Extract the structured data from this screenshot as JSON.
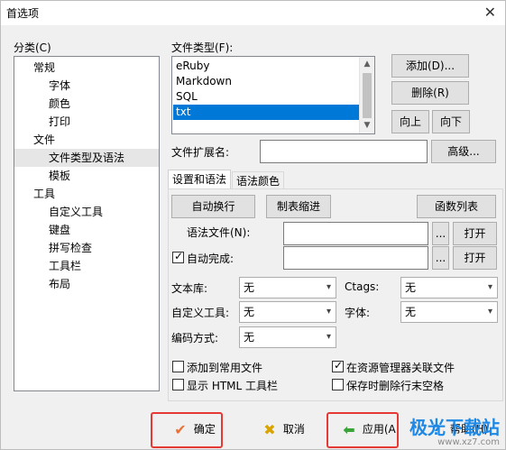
{
  "window": {
    "title": "首选项"
  },
  "category": {
    "label": "分类(C)",
    "items": [
      {
        "label": "常规",
        "level": 0
      },
      {
        "label": "字体",
        "level": 1
      },
      {
        "label": "颜色",
        "level": 1
      },
      {
        "label": "打印",
        "level": 1
      },
      {
        "label": "文件",
        "level": 0
      },
      {
        "label": "文件类型及语法",
        "level": 1,
        "selected": true
      },
      {
        "label": "模板",
        "level": 1
      },
      {
        "label": "工具",
        "level": 0
      },
      {
        "label": "自定义工具",
        "level": 1
      },
      {
        "label": "键盘",
        "level": 1
      },
      {
        "label": "拼写检查",
        "level": 1
      },
      {
        "label": "工具栏",
        "level": 1
      },
      {
        "label": "布局",
        "level": 1
      }
    ]
  },
  "file_type": {
    "label": "文件类型(F):",
    "items": [
      "eRuby",
      "Markdown",
      "SQL",
      "txt"
    ],
    "selected": "txt",
    "buttons": {
      "add": "添加(D)...",
      "delete": "删除(R)",
      "up": "向上",
      "down": "向下"
    }
  },
  "extension": {
    "label": "文件扩展名:",
    "value": "",
    "advanced": "高级..."
  },
  "tabs": {
    "syntax": "设置和语法",
    "color": "语法颜色"
  },
  "syntax": {
    "auto_wrap": "自动换行",
    "tab_indent": "制表缩进",
    "function_list": "函数列表",
    "syntax_file_label": "语法文件(N):",
    "syntax_file_value": "",
    "auto_complete_label": "自动完成:",
    "auto_complete_checked": true,
    "auto_complete_value": "",
    "browse": "...",
    "open": "打开"
  },
  "dropdowns": {
    "library": {
      "label": "文本库:",
      "value": "无"
    },
    "ctags": {
      "label": "Ctags:",
      "value": "无"
    },
    "custom_tool": {
      "label": "自定义工具:",
      "value": "无"
    },
    "font": {
      "label": "字体:",
      "value": "无"
    },
    "encoding": {
      "label": "编码方式:",
      "value": "无"
    }
  },
  "checkboxes": {
    "add_common": {
      "label": "添加到常用文件",
      "checked": false
    },
    "explorer_assoc": {
      "label": "在资源管理器关联文件",
      "checked": true
    },
    "html_toolbar": {
      "label": "显示 HTML 工具栏",
      "checked": false
    },
    "trim_trailing": {
      "label": "保存时删除行末空格",
      "checked": false
    }
  },
  "footer": {
    "ok": "确定",
    "cancel": "取消",
    "apply": "应用(A",
    "help": "帮助(H)"
  },
  "watermark": {
    "title": "极光下载站",
    "url": "www.xz7.com"
  },
  "colors": {
    "selection": "#0078d7",
    "highlight_box": "#e53935"
  }
}
